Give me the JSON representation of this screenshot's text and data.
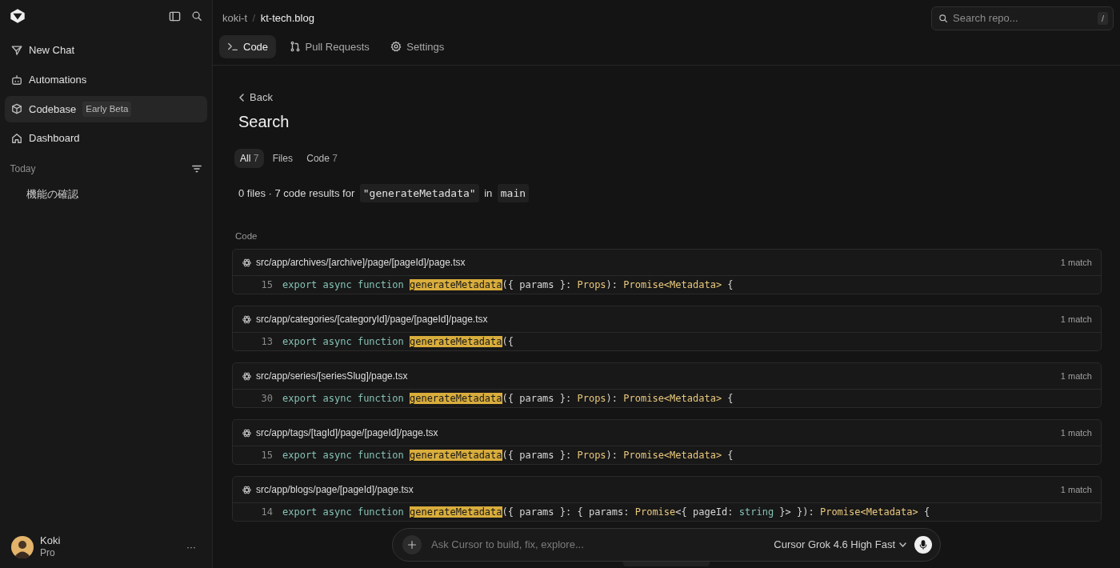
{
  "sidebar": {
    "nav_items": [
      {
        "label": "New Chat",
        "selected": false
      },
      {
        "label": "Automations",
        "selected": false
      },
      {
        "label": "Codebase",
        "badge": "Early Beta",
        "selected": true
      },
      {
        "label": "Dashboard",
        "selected": false
      }
    ],
    "section_title": "Today",
    "chats": [
      {
        "label": "機能の確認"
      }
    ],
    "user": {
      "name": "Koki",
      "plan": "Pro",
      "menu": "···"
    }
  },
  "breadcrumb": {
    "owner": "koki-t",
    "separator": "/",
    "repo": "kt-tech.blog"
  },
  "repo_tabs": [
    {
      "label": "Code",
      "selected": true
    },
    {
      "label": "Pull Requests",
      "selected": false
    },
    {
      "label": "Settings",
      "selected": false
    }
  ],
  "search_box": {
    "placeholder": "Search repo...",
    "shortcut": "/"
  },
  "back": "Back",
  "title": "Search",
  "filter_tabs": [
    {
      "label": "All",
      "count": "7",
      "selected": true
    },
    {
      "label": "Files",
      "selected": false
    },
    {
      "label": "Code",
      "count": "7",
      "selected": false
    }
  ],
  "summary": {
    "text": "0 files · 7 code results for",
    "query": "\"generateMetadata\"",
    "joiner": "in",
    "branch": "main"
  },
  "section_label": "Code",
  "results": [
    {
      "path": "src/app/archives/[archive]/page/[pageId]/page.tsx",
      "matches": "1 match",
      "line_number": "15",
      "tokens": [
        {
          "kind": "keyword",
          "text": "export async function "
        },
        {
          "kind": "match",
          "text": "generateMetadata"
        },
        {
          "kind": "plain",
          "text": "({ params }: "
        },
        {
          "kind": "type",
          "text": "Props"
        },
        {
          "kind": "plain",
          "text": "): "
        },
        {
          "kind": "type",
          "text": "Promise<Metadata>"
        },
        {
          "kind": "plain",
          "text": " {"
        }
      ]
    },
    {
      "path": "src/app/categories/[categoryId]/page/[pageId]/page.tsx",
      "matches": "1 match",
      "line_number": "13",
      "tokens": [
        {
          "kind": "keyword",
          "text": "export async function "
        },
        {
          "kind": "match",
          "text": "generateMetadata"
        },
        {
          "kind": "plain",
          "text": "({"
        }
      ]
    },
    {
      "path": "src/app/series/[seriesSlug]/page.tsx",
      "matches": "1 match",
      "line_number": "30",
      "tokens": [
        {
          "kind": "keyword",
          "text": "export async function "
        },
        {
          "kind": "match",
          "text": "generateMetadata"
        },
        {
          "kind": "plain",
          "text": "({ params }: "
        },
        {
          "kind": "type",
          "text": "Props"
        },
        {
          "kind": "plain",
          "text": "): "
        },
        {
          "kind": "type",
          "text": "Promise<Metadata>"
        },
        {
          "kind": "plain",
          "text": " {"
        }
      ]
    },
    {
      "path": "src/app/tags/[tagId]/page/[pageId]/page.tsx",
      "matches": "1 match",
      "line_number": "15",
      "tokens": [
        {
          "kind": "keyword",
          "text": "export async function "
        },
        {
          "kind": "match",
          "text": "generateMetadata"
        },
        {
          "kind": "plain",
          "text": "({ params }: "
        },
        {
          "kind": "type",
          "text": "Props"
        },
        {
          "kind": "plain",
          "text": "): "
        },
        {
          "kind": "type",
          "text": "Promise<Metadata>"
        },
        {
          "kind": "plain",
          "text": " {"
        }
      ]
    },
    {
      "path": "src/app/blogs/page/[pageId]/page.tsx",
      "matches": "1 match",
      "line_number": "14",
      "tokens": [
        {
          "kind": "keyword",
          "text": "export async function "
        },
        {
          "kind": "match",
          "text": "generateMetadata"
        },
        {
          "kind": "plain",
          "text": "({ params }: { params: "
        },
        {
          "kind": "type",
          "text": "Promise"
        },
        {
          "kind": "plain",
          "text": "<{ pageId: "
        },
        {
          "kind": "keyword",
          "text": "string"
        },
        {
          "kind": "plain",
          "text": " }> }): "
        },
        {
          "kind": "type",
          "text": "Promise<Metadata>"
        },
        {
          "kind": "plain",
          "text": " {"
        }
      ]
    }
  ],
  "composer": {
    "placeholder": "Ask Cursor to build, fix, explore...",
    "model": "Cursor Grok 4.6 High Fast"
  }
}
